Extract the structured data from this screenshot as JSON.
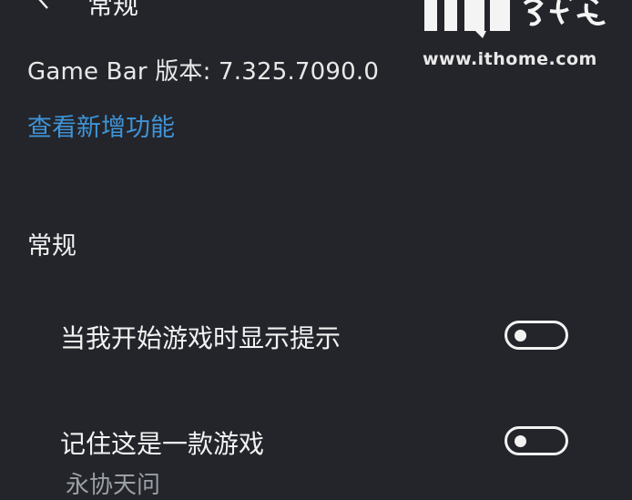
{
  "header": {
    "title": "常规",
    "back_icon": "chevron-left-icon"
  },
  "info": {
    "version": "Game Bar 版本: 7.325.7090.0",
    "whats_new_link": "查看新增功能"
  },
  "section": {
    "title": "常规"
  },
  "settings": [
    {
      "label": "当我开始游戏时显示提示",
      "toggle_state": "off"
    },
    {
      "label": "记住这是一款游戏",
      "toggle_state": "off"
    }
  ],
  "cut_text": "永协天问",
  "watermark": {
    "url": "www.ithome.com"
  },
  "colors": {
    "background": "#23252b",
    "accent_link": "#3f93d6",
    "text": "#f2f2f2"
  }
}
